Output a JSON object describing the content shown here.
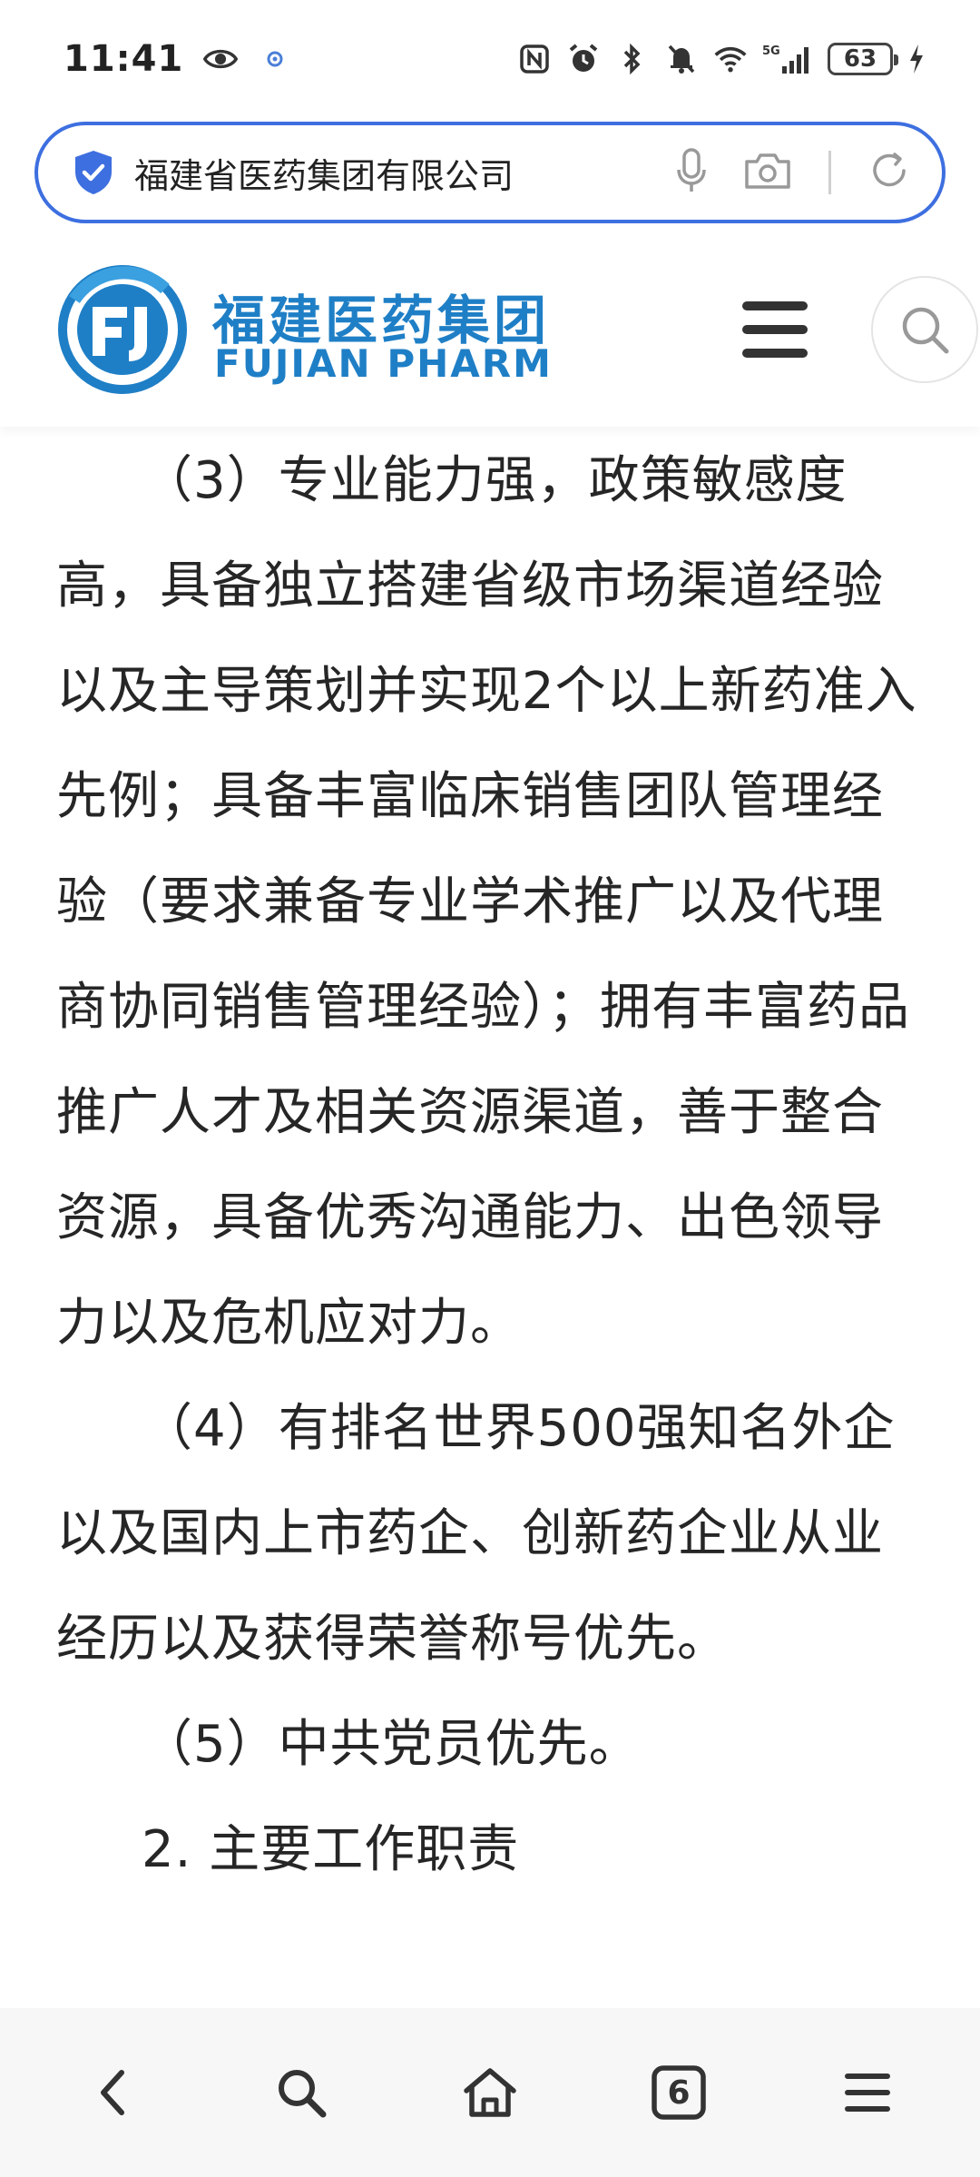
{
  "status_bar": {
    "time": "11:41",
    "battery": "63"
  },
  "search_bar": {
    "query": "福建省医药集团有限公司"
  },
  "site_header": {
    "logo_cn": "福建医药集团",
    "logo_en": "FUJIAN PHARM",
    "logo_mark": "FJ"
  },
  "content": {
    "paragraphs": [
      "（3）专业能力强，政策敏感度高，具备独立搭建省级市场渠道经验以及主导策划并实现2个以上新药准入先例；具备丰富临床销售团队管理经验（要求兼备专业学术推广以及代理商协同销售管理经验）；拥有丰富药品推广人才及相关资源渠道，善于整合资源，具备优秀沟通能力、出色领导力以及危机应对力。",
      "（4）有排名世界500强知名外企以及国内上市药企、创新药企业从业经历以及获得荣誉称号优先。",
      "（5）中共党员优先。",
      "2. 主要工作职责"
    ]
  },
  "bottom_nav": {
    "tabs_count": "6"
  },
  "colors": {
    "accent": "#3d6fe0",
    "brand": "#1f7fc6"
  }
}
